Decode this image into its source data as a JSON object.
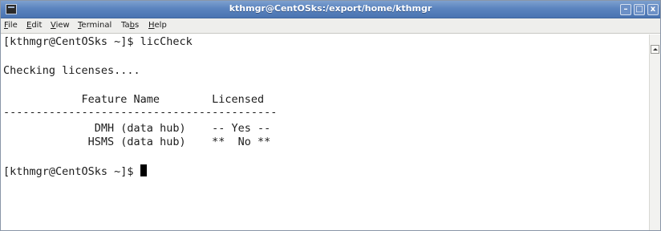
{
  "window": {
    "title": "kthmgr@CentOSks:/export/home/kthmgr",
    "icon": "terminal-icon",
    "buttons": [
      "minimize-icon",
      "maximize-icon",
      "close-icon"
    ],
    "close_glyph": "x"
  },
  "menubar": {
    "items": [
      {
        "mnemonic": "F",
        "rest": "ile"
      },
      {
        "mnemonic": "E",
        "rest": "dit"
      },
      {
        "mnemonic": "V",
        "rest": "iew"
      },
      {
        "mnemonic": "T",
        "rest": "erminal"
      },
      {
        "prefix": "Ta",
        "mnemonic": "b",
        "rest": "s"
      },
      {
        "mnemonic": "H",
        "rest": "elp"
      }
    ]
  },
  "terminal": {
    "lines": [
      "[kthmgr@CentOSks ~]$ licCheck",
      "",
      "Checking licenses....",
      "",
      "            Feature Name        Licensed",
      "------------------------------------------",
      "              DMH (data hub)    -- Yes --",
      "             HSMS (data hub)    **  No **",
      "",
      "[kthmgr@CentOSks ~]$ "
    ],
    "colors": {
      "background": "#ffffff",
      "text": "#1c1c1c",
      "cursor": "#000000"
    }
  },
  "colors": {
    "titlebar": "#5b84bf",
    "menubar": "#eeeeec"
  }
}
